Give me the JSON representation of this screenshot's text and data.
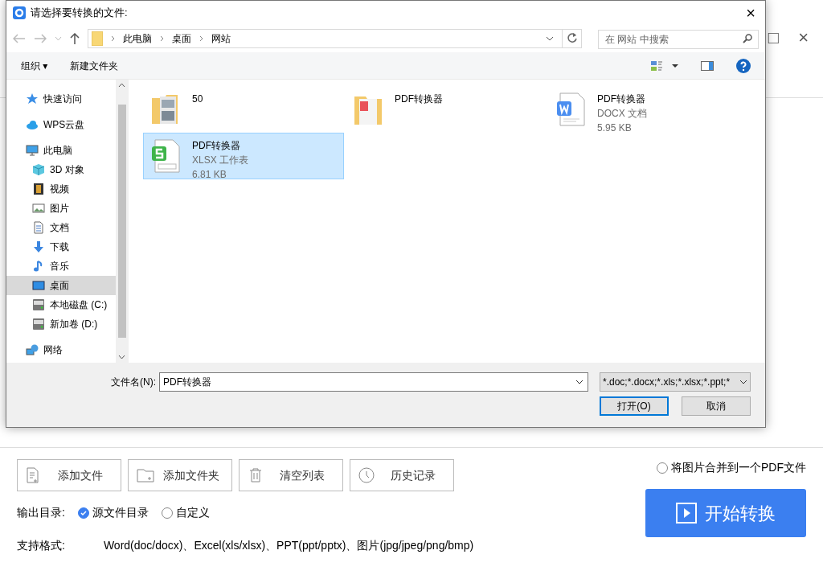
{
  "app": {
    "window_controls": [
      "□",
      "×"
    ],
    "tools": [
      {
        "kind": "file",
        "label": "添加文件"
      },
      {
        "kind": "folder",
        "label": "添加文件夹"
      },
      {
        "kind": "trash",
        "label": "清空列表"
      },
      {
        "kind": "clock",
        "label": "历史记录"
      }
    ],
    "merge_option": {
      "label": "将图片合并到一个PDF文件",
      "checked": false
    },
    "output": {
      "label": "输出目录:",
      "options": [
        {
          "label": "源文件目录",
          "selected": true
        },
        {
          "label": "自定义",
          "selected": false
        }
      ]
    },
    "formats": {
      "label": "支持格式:",
      "text": "Word(doc/docx)、Excel(xls/xlsx)、PPT(ppt/pptx)、图片(jpg/jpeg/png/bmp)"
    },
    "start_button": "开始转换"
  },
  "dialog": {
    "title": "请选择要转换的文件:",
    "close": "×",
    "breadcrumbs": [
      "此电脑",
      "桌面",
      "网站"
    ],
    "search": {
      "placeholder": "在 网站 中搜索"
    },
    "toolbar": {
      "organize": "组织 ▾",
      "new_folder": "新建文件夹"
    },
    "sidebar": [
      {
        "kind": "star",
        "label": "快速访问",
        "selected": false
      },
      {
        "kind": "cloud",
        "label": "WPS云盘",
        "selected": false
      },
      {
        "kind": "pc",
        "label": "此电脑",
        "selected": false,
        "children": [
          {
            "kind": "cube",
            "label": "3D 对象",
            "selected": false
          },
          {
            "kind": "film",
            "label": "视频",
            "selected": false
          },
          {
            "kind": "image",
            "label": "图片",
            "selected": false
          },
          {
            "kind": "doc",
            "label": "文档",
            "selected": false
          },
          {
            "kind": "download",
            "label": "下载",
            "selected": false
          },
          {
            "kind": "music",
            "label": "音乐",
            "selected": false
          },
          {
            "kind": "desktop",
            "label": "桌面",
            "selected": true
          },
          {
            "kind": "drive",
            "label": "本地磁盘 (C:)",
            "selected": false
          },
          {
            "kind": "drive",
            "label": "新加卷 (D:)",
            "selected": false
          }
        ]
      },
      {
        "kind": "network",
        "label": "网络",
        "selected": false
      }
    ],
    "files": [
      {
        "kind": "photo-folder",
        "name": "50",
        "selected": false
      },
      {
        "kind": "pdf-folder",
        "name": "PDF转换器",
        "selected": false
      },
      {
        "kind": "docx",
        "name": "PDF转换器",
        "type": "DOCX 文档",
        "size": "5.95 KB",
        "selected": false
      },
      {
        "kind": "xlsx",
        "name": "PDF转换器",
        "type": "XLSX 工作表",
        "size": "6.81 KB",
        "selected": true
      }
    ],
    "filename_label": "文件名(N):",
    "filename": "PDF转换器",
    "filter": "*.doc;*.docx;*.xls;*.xlsx;*.ppt;*",
    "buttons": [
      "打开(O)",
      "取消"
    ]
  }
}
